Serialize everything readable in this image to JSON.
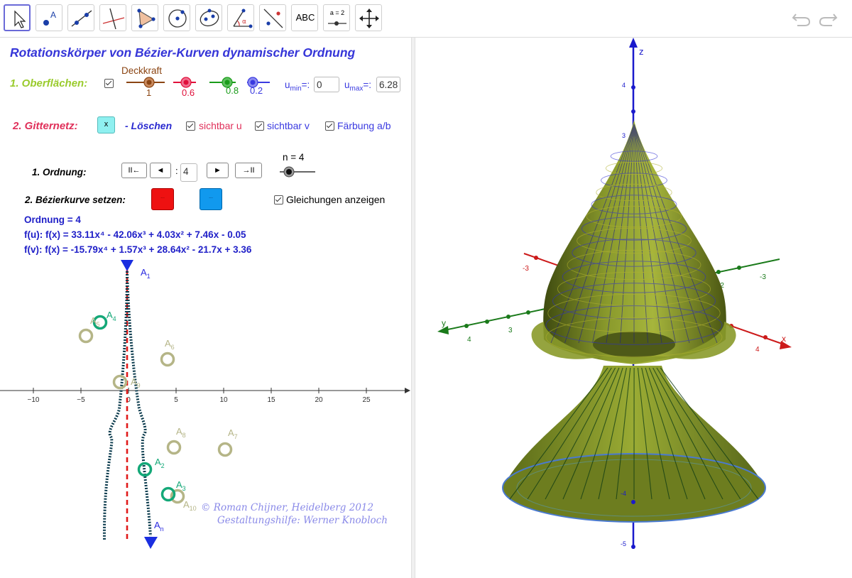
{
  "toolbar": {
    "tools": [
      {
        "name": "move-tool",
        "label": ""
      },
      {
        "name": "point-tool",
        "label": "A"
      },
      {
        "name": "line-tool",
        "label": ""
      },
      {
        "name": "perpendicular-tool",
        "label": ""
      },
      {
        "name": "polygon-tool",
        "label": ""
      },
      {
        "name": "circle-tool",
        "label": ""
      },
      {
        "name": "ellipse-tool",
        "label": ""
      },
      {
        "name": "angle-tool",
        "label": "α"
      },
      {
        "name": "reflect-tool",
        "label": ""
      },
      {
        "name": "text-tool",
        "label": "ABC"
      },
      {
        "name": "slider-tool",
        "label": "a = 2"
      },
      {
        "name": "move-view-tool",
        "label": ""
      }
    ]
  },
  "panel": {
    "title": "Rotationskörper von Bézier-Kurven dynamischer Ordnung",
    "section1": {
      "label": "1. Oberflächen:",
      "deckkraft_label": "Deckkraft",
      "sliders": [
        {
          "color": "#8b4513",
          "value": "1",
          "level": 1
        },
        {
          "color": "#e0103a",
          "value": "0.6",
          "level": 0.6
        },
        {
          "color": "#1a9c1a",
          "value": "0.8",
          "level": 0.8
        },
        {
          "color": "#3a3ae0",
          "value": "0.2",
          "level": 0.2
        }
      ],
      "umin_label": "u",
      "umin_sub": "min",
      "umin_eq": "=:",
      "umin_value": "0",
      "umax_label": "u",
      "umax_sub": "max",
      "umax_eq": "=:",
      "umax_value": "6.28"
    },
    "section2": {
      "label": "2. Gitternetz:",
      "clear_button": "x",
      "clear_label": "- Löschen",
      "visible_u": "sichtbar u",
      "visible_v": "sichtbar v",
      "coloring": "Färbung a/b"
    },
    "order": {
      "label": "1. Ordnung:",
      "first_btn": "II←",
      "prev_btn": "◄",
      "colon": ":",
      "value": "4",
      "next_btn": "►",
      "last_btn": "→II",
      "n_label": "n = 4"
    },
    "bezier": {
      "label": "2. Bézierkurve setzen:",
      "btn_red": "...",
      "btn_blue": "...",
      "show_eq": "Gleichungen anzeigen"
    },
    "equations": {
      "order": "Ordnung = 4",
      "fu": "f(u): f(x) = 33.11x⁴ - 42.06x³ + 4.03x² + 7.46x - 0.05",
      "fv": "f(v): f(x) = -15.79x⁴ + 1.57x³ + 28.64x² - 21.7x + 3.36"
    },
    "axis_ticks": [
      "−10",
      "−5",
      "0",
      "5",
      "10",
      "15",
      "20",
      "25"
    ],
    "points": [
      {
        "name": "A",
        "sub": "1"
      },
      {
        "name": "A",
        "sub": "2"
      },
      {
        "name": "A",
        "sub": "3"
      },
      {
        "name": "A",
        "sub": "4"
      },
      {
        "name": "A",
        "sub": "5"
      },
      {
        "name": "A",
        "sub": "6"
      },
      {
        "name": "A",
        "sub": "7"
      },
      {
        "name": "A",
        "sub": "8"
      },
      {
        "name": "A",
        "sub": "9"
      },
      {
        "name": "A",
        "sub": "10"
      },
      {
        "name": "A",
        "sub": "n"
      }
    ],
    "credit1": "© Roman Chijner, Heidelberg 2012",
    "credit2": "Gestaltungshilfe: Werner Knobloch"
  },
  "view3d": {
    "axis_z": "z",
    "axis_x": "x",
    "axis_y": "y",
    "z_ticks": [
      "4",
      "3",
      "-4",
      "-5"
    ],
    "x_ticks": [
      "-3",
      "-2",
      "4"
    ],
    "y_ticks": [
      "4",
      "3",
      "-2",
      "-3"
    ],
    "colors": {
      "surface": "#7a8a22",
      "x_axis": "#cc1a1a",
      "y_axis": "#1a7a1a",
      "z_axis": "#1a1acc"
    }
  }
}
